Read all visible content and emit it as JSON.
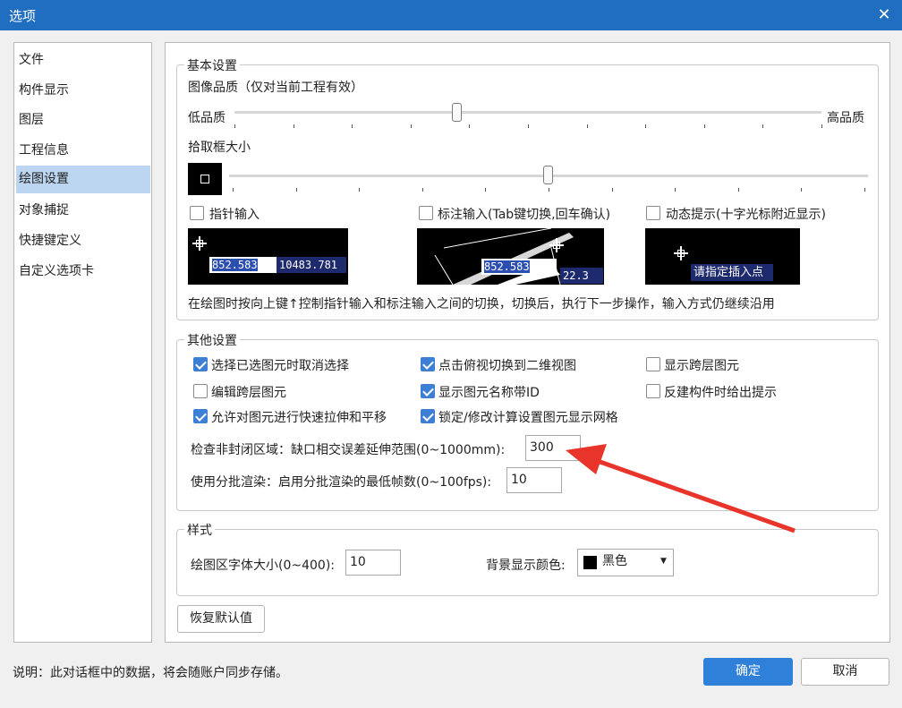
{
  "window": {
    "title": "选项",
    "close_icon": "close-icon"
  },
  "nav": {
    "items": [
      {
        "label": "文件"
      },
      {
        "label": "构件显示"
      },
      {
        "label": "图层"
      },
      {
        "label": "工程信息"
      },
      {
        "label": "绘图设置",
        "selected": true
      },
      {
        "label": "对象捕捉"
      },
      {
        "label": "快捷键定义"
      },
      {
        "label": "自定义选项卡"
      }
    ]
  },
  "basic": {
    "title": "基本设置",
    "image_quality_label": "图像品质（仅对当前工程有效）",
    "low_quality": "低品质",
    "high_quality": "高品质",
    "image_quality_level": 0.38,
    "pickbox_label": "拾取框大小",
    "pickbox_level": 0.5,
    "pointer_input": "指针输入",
    "dimension_input": "标注输入(Tab键切换,回车确认)",
    "dynamic_prompt": "动态提示(十字光标附近显示)",
    "preview1_value1": "852.583",
    "preview1_value2": "10483.781",
    "preview2_value1": "852.583",
    "preview2_value2": "22.3",
    "preview3_text": "请指定插入点",
    "description": "在绘图时按向上键↑控制指针输入和标注输入之间的切换，切换后，执行下一步操作，输入方式仍继续沿用"
  },
  "other": {
    "title": "其他设置",
    "checkboxes": [
      {
        "label": "选择已选图元时取消选择",
        "checked": true
      },
      {
        "label": "点击俯视切换到二维视图",
        "checked": true
      },
      {
        "label": "显示跨层图元",
        "checked": false
      },
      {
        "label": "编辑跨层图元",
        "checked": false
      },
      {
        "label": "显示图元名称带ID",
        "checked": true
      },
      {
        "label": "反建构件时给出提示",
        "checked": false
      },
      {
        "label": "允许对图元进行快速拉伸和平移",
        "checked": true
      },
      {
        "label": "锁定/修改计算设置图元显示网格",
        "checked": true
      }
    ],
    "gap_label": "检查非封闭区域：缺口相交误差延伸范围(0~1000mm):",
    "gap_value": "300",
    "batch_label": "使用分批渲染：启用分批渲染的最低帧数(0~100fps):",
    "batch_value": "10"
  },
  "style": {
    "title": "样式",
    "font_size_label": "绘图区字体大小(0~400):",
    "font_size_value": "10",
    "bg_color_label": "背景显示颜色:",
    "bg_color_value": "黑色",
    "bg_color_swatch": "#000000"
  },
  "restore_button": "恢复默认值",
  "footer": {
    "note": "说明：此对话框中的数据，将会随账户同步存储。",
    "ok": "确定",
    "cancel": "取消"
  },
  "colors": {
    "titlebar": "#1f6ec2",
    "selected_nav": "#bcd5f0",
    "accent": "#2f80d9",
    "arrow": "#e8342a"
  }
}
